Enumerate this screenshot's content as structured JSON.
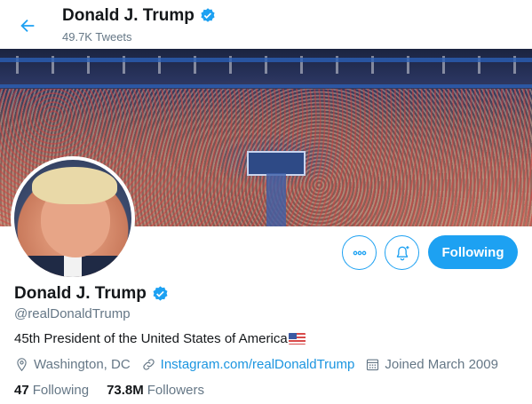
{
  "header": {
    "name": "Donald J. Trump",
    "tweet_count": "49.7K Tweets"
  },
  "profile": {
    "display_name": "Donald J. Trump",
    "handle": "@realDonaldTrump",
    "bio": "45th President of the United States of America",
    "location": "Washington, DC",
    "website": "Instagram.com/realDonaldTrump",
    "joined": "Joined March 2009",
    "following_count": "47",
    "following_label": "Following",
    "followers_count": "73.8M",
    "followers_label": "Followers"
  },
  "actions": {
    "follow_state_label": "Following"
  },
  "icons": {
    "back": "arrow-left-icon",
    "verified": "verified-badge-icon",
    "more": "more-dots-icon",
    "notify": "bell-plus-icon",
    "location": "location-pin-icon",
    "link": "link-icon",
    "calendar": "calendar-icon",
    "flag": "us-flag-icon"
  },
  "colors": {
    "accent": "#1da1f2",
    "link": "#1b95e0",
    "secondary_text": "#657786",
    "primary_text": "#14171a"
  }
}
